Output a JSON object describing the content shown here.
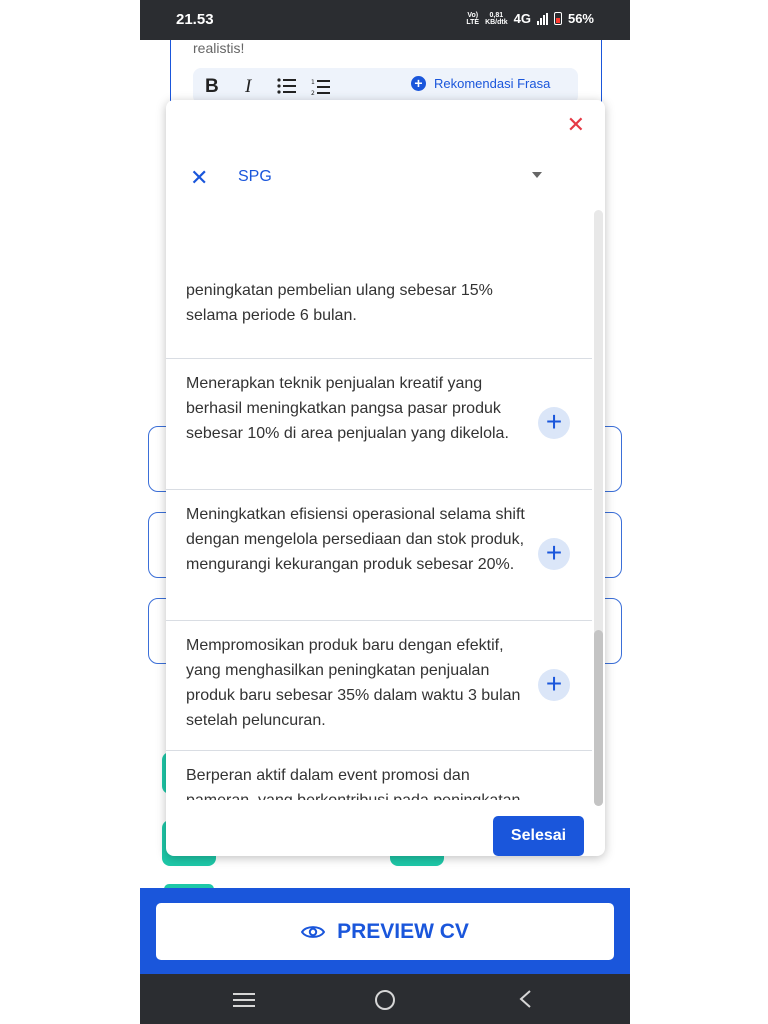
{
  "status_bar": {
    "time": "21.53",
    "volte_top": "Vo)",
    "volte_bottom": "LTE",
    "speed_top": "0,81",
    "speed_bottom": "KB/dtk",
    "network": "4G",
    "battery": "56%"
  },
  "editor": {
    "hint_text": "realistis!",
    "toolbar": {
      "bold": "B",
      "italic": "I",
      "recommend_label": "Rekomendasi Frasa"
    }
  },
  "modal": {
    "close_glyph": "✕",
    "clear_glyph": "✕",
    "selected_value": "SPG",
    "items": [
      {
        "text": "peningkatan pembelian ulang sebesar 15% selama periode 6 bulan."
      },
      {
        "text": "Menerapkan teknik penjualan kreatif yang berhasil meningkatkan pangsa pasar produk sebesar 10% di area penjualan yang dikelola."
      },
      {
        "text": "Meningkatkan efisiensi operasional selama shift dengan mengelola persediaan dan stok produk, mengurangi kekurangan produk sebesar 20%."
      },
      {
        "text": "Mempromosikan produk baru dengan efektif, yang menghasilkan peningkatan penjualan produk baru sebesar 35% dalam waktu 3 bulan setelah peluncuran."
      },
      {
        "text": "Berperan aktif dalam event promosi dan pameran, yang berkontribusi pada peningkatan eksposur merek dan peningkatan penjualan sebesar 28% selama event."
      }
    ],
    "done_label": "Selesai"
  },
  "preview": {
    "label": "PREVIEW CV"
  },
  "colors": {
    "primary": "#1a56db",
    "danger": "#e53945",
    "teal": "#1ec8a8"
  }
}
